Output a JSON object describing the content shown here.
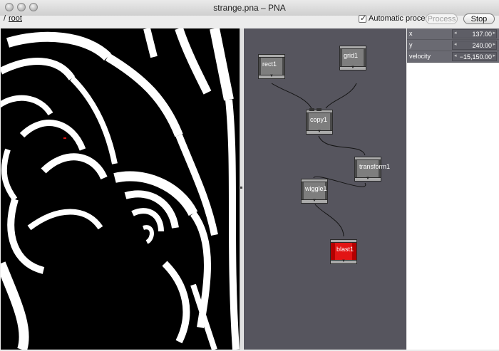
{
  "window": {
    "title": "strange.pna – PNA"
  },
  "breadcrumb": {
    "separator": "/",
    "root": "root"
  },
  "toolbar": {
    "auto_process_label": "Automatic process",
    "auto_process_checked": "✓",
    "process_label": "Process",
    "stop_label": "Stop"
  },
  "network": {
    "nodes": [
      "rect1",
      "grid1",
      "copy1",
      "transform1",
      "wiggle1",
      "blast1"
    ],
    "rendered_node": "blast1",
    "render_color": "#e21414"
  },
  "params": [
    {
      "name": "x",
      "value": "137.00"
    },
    {
      "name": "y",
      "value": "240.00"
    },
    {
      "name": "velocity",
      "value": "−15,150.00"
    }
  ],
  "colors": {
    "network_bg": "#56555e",
    "param_bg": "#6a6a72",
    "viewer_bg": "#000000"
  }
}
